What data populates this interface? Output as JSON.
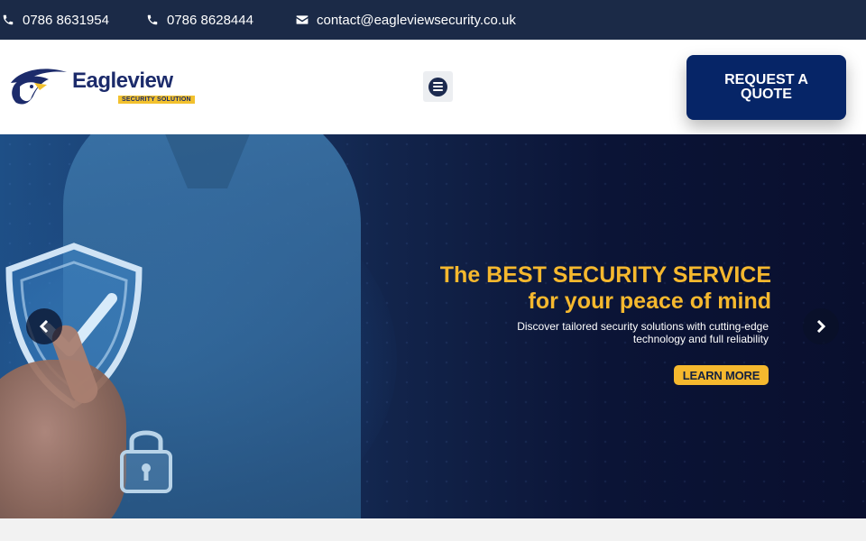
{
  "topbar": {
    "phone1": "0786 8631954",
    "phone2": "0786 8628444",
    "email": "contact@eagleviewsecurity.co.uk",
    "icons": [
      "phone-icon",
      "phone-icon",
      "envelope-icon"
    ]
  },
  "header": {
    "logo_name": "Eagleview",
    "logo_tagline": "SECURITY SOLUTION",
    "menu_icon": "hamburger-menu-icon",
    "quote_button": "REQUEST A QUOTE"
  },
  "hero": {
    "title_line1": "The BEST SECURITY SERVICE",
    "title_line2": "for your peace of mind",
    "subtitle": "Discover tailored security solutions with cutting-edge technology and full reliability",
    "cta": "LEARN MORE",
    "prev_icon": "chevron-left-icon",
    "next_icon": "chevron-right-icon"
  },
  "colors": {
    "topbar_bg": "#1b2a47",
    "brand_navy": "#062567",
    "accent_gold": "#f5b82e"
  }
}
